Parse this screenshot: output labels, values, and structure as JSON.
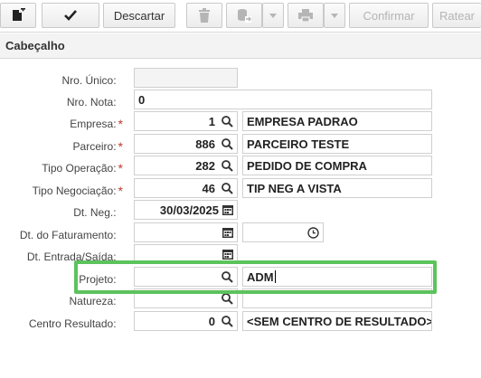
{
  "toolbar": {
    "new_icon": "new-document-icon",
    "confirm_check_icon": "check-icon",
    "discard_label": "Descartar",
    "delete_icon": "trash-icon",
    "export_icon": "export-database-icon",
    "print_icon": "printer-icon",
    "confirm_label": "Confirmar",
    "rateio_label": "Ratear"
  },
  "section": {
    "title": "Cabeçalho"
  },
  "fields": {
    "nro_unico": {
      "label": "Nro. Único:",
      "value": ""
    },
    "nro_nota": {
      "label": "Nro. Nota:",
      "value": "0"
    },
    "empresa": {
      "label": "Empresa:",
      "code": "1",
      "desc": "EMPRESA PADRAO"
    },
    "parceiro": {
      "label": "Parceiro:",
      "code": "886",
      "desc": "PARCEIRO TESTE"
    },
    "tipo_operacao": {
      "label": "Tipo Operação:",
      "code": "282",
      "desc": "PEDIDO DE COMPRA"
    },
    "tipo_negociacao": {
      "label": "Tipo Negociação:",
      "code": "46",
      "desc": "TIP NEG A VISTA"
    },
    "dt_neg": {
      "label": "Dt. Neg.:",
      "value": "30/03/2025"
    },
    "dt_faturamento": {
      "label": "Dt. do Faturamento:",
      "value": "",
      "time": ""
    },
    "dt_entrada_saida": {
      "label": "Dt. Entrada/Saída:",
      "value": ""
    },
    "projeto": {
      "label": "Projeto:",
      "code": "",
      "desc": "ADM"
    },
    "natureza": {
      "label": "Natureza:",
      "code": "",
      "desc": ""
    },
    "centro_resultado": {
      "label": "Centro Resultado:",
      "code": "0",
      "desc": "<SEM CENTRO DE RESULTADO>"
    }
  },
  "required_marker": "*",
  "colors": {
    "highlight": "#5cc35c",
    "required": "#c0392b"
  }
}
